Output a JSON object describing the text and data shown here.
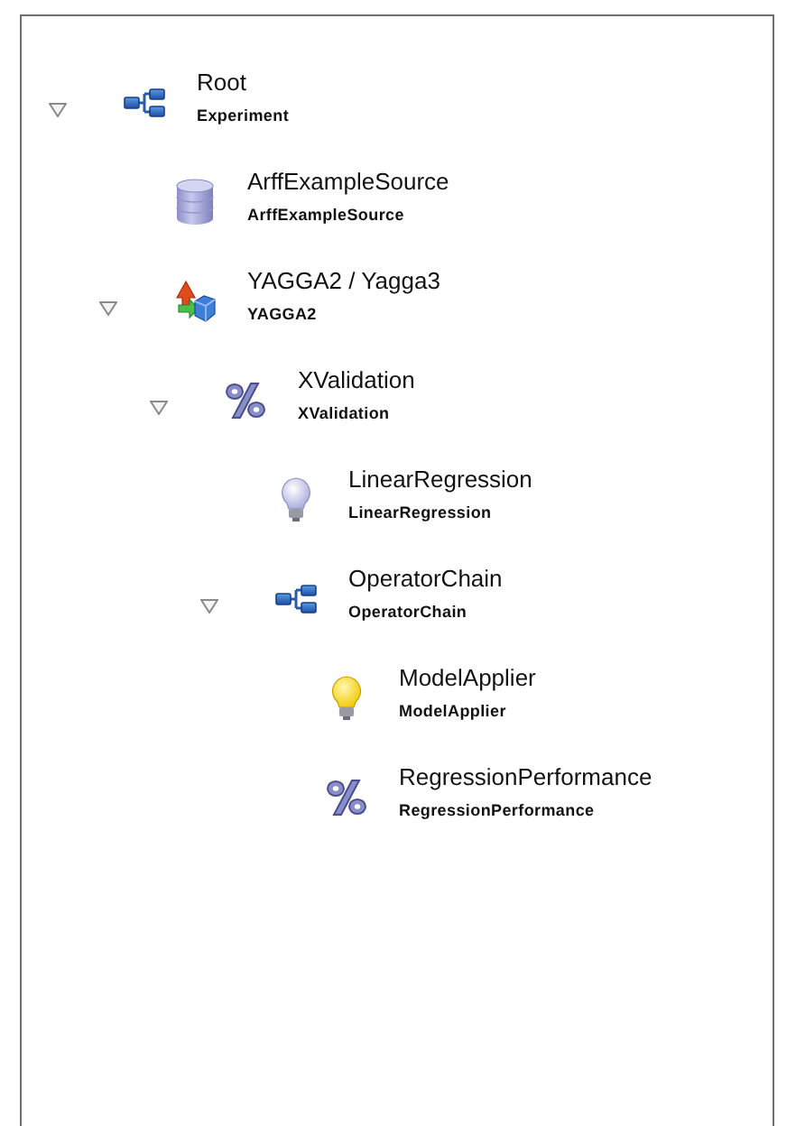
{
  "tree": [
    {
      "name": "Root",
      "class": "Experiment",
      "kind": "chain",
      "expanded": true,
      "children": [
        {
          "name": "ArffExampleSource",
          "class": "ArffExampleSource",
          "kind": "database"
        },
        {
          "name": "YAGGA2 / Yagga3",
          "class": "YAGGA2",
          "kind": "shapes",
          "expanded": true,
          "children": [
            {
              "name": "XValidation",
              "class": "XValidation",
              "kind": "percent",
              "expanded": true,
              "children": [
                {
                  "name": "LinearRegression",
                  "class": "LinearRegression",
                  "kind": "bulb-off"
                },
                {
                  "name": "OperatorChain",
                  "class": "OperatorChain",
                  "kind": "chain",
                  "expanded": true,
                  "children": [
                    {
                      "name": "ModelApplier",
                      "class": "ModelApplier",
                      "kind": "bulb-on"
                    },
                    {
                      "name": "RegressionPerformance",
                      "class": "RegressionPerformance",
                      "kind": "percent"
                    }
                  ]
                }
              ]
            }
          ]
        }
      ]
    }
  ]
}
